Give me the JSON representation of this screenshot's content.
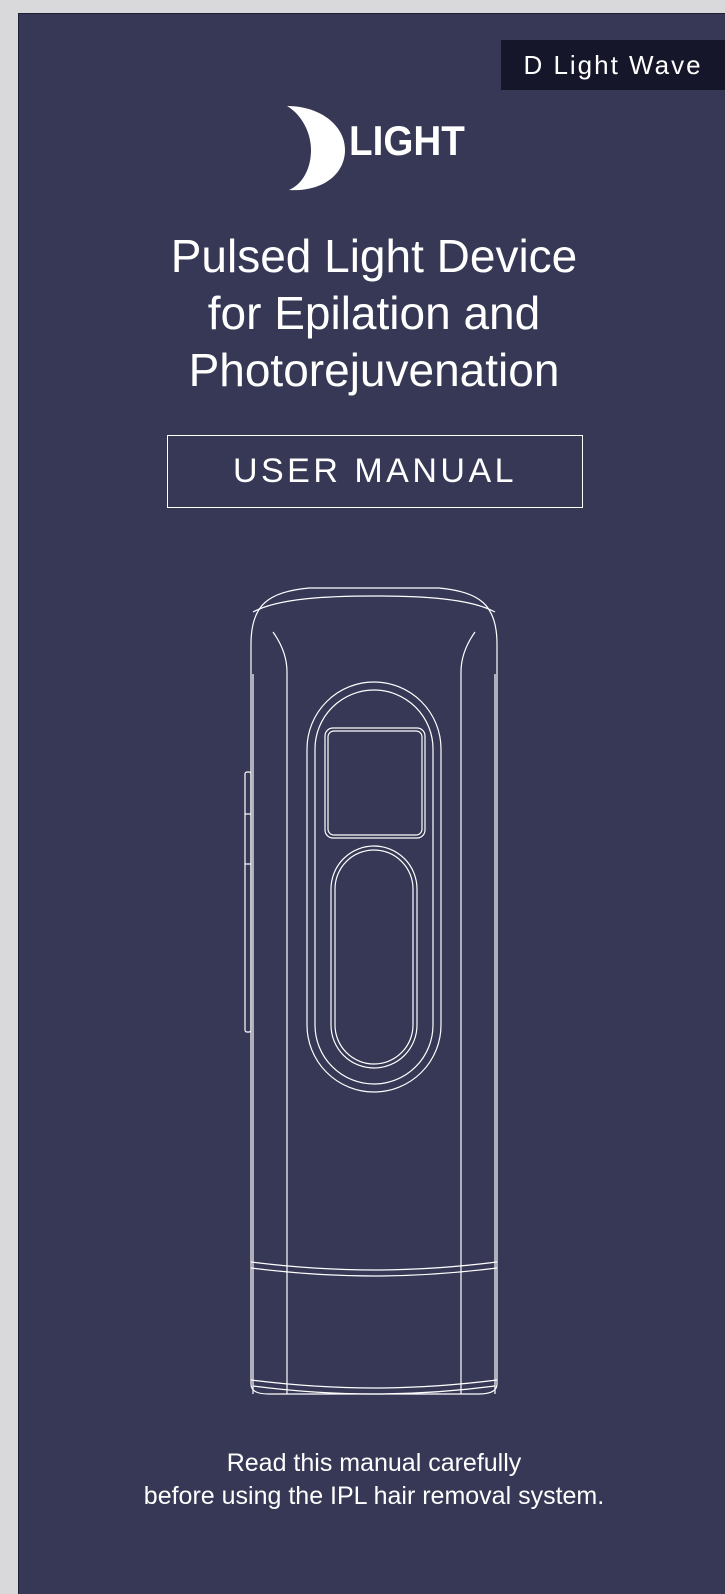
{
  "cover": {
    "product_name": "D Light Wave",
    "logo_text": "LIGHT",
    "title_lines": [
      "Pulsed Light Device",
      "for Epilation and",
      "Photorejuvenation"
    ],
    "manual_label": "USER MANUAL",
    "note_lines": [
      "Read this manual carefully",
      "before using the IPL hair removal system."
    ]
  },
  "colors": {
    "page_background": "#363855",
    "tag_background": "#151629",
    "outer_background": "#d9d9db",
    "text": "#ffffff"
  },
  "icons": {
    "logo": "d-crescent-logo-icon",
    "device": "ipl-device-illustration"
  }
}
